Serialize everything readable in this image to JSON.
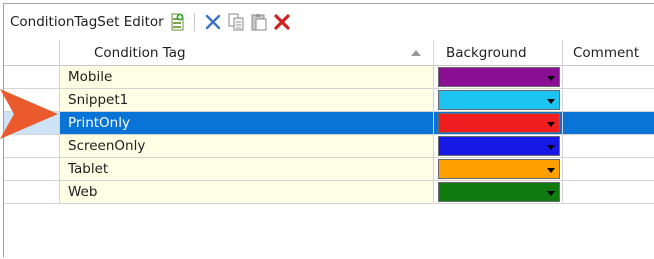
{
  "toolbar": {
    "title": "ConditionTagSet Editor",
    "buttons": [
      {
        "name": "new-tag-button",
        "icon": "add-document-icon"
      },
      {
        "name": "cut-button",
        "icon": "scissors-icon"
      },
      {
        "name": "copy-button",
        "icon": "copy-icon"
      },
      {
        "name": "paste-button",
        "icon": "paste-icon"
      },
      {
        "name": "delete-button",
        "icon": "red-x-icon"
      }
    ]
  },
  "grid": {
    "columns": {
      "tag": "Condition Tag",
      "background": "Background",
      "comment": "Comment"
    },
    "rows": [
      {
        "tag": "Mobile",
        "color": "#8b0f95",
        "comment": ""
      },
      {
        "tag": "Snippet1",
        "color": "#1cc4f2",
        "comment": ""
      },
      {
        "tag": "PrintOnly",
        "color": "#f01e1e",
        "comment": "",
        "selected": true
      },
      {
        "tag": "ScreenOnly",
        "color": "#1717e6",
        "comment": ""
      },
      {
        "tag": "Tablet",
        "color": "#ffa000",
        "comment": ""
      },
      {
        "tag": "Web",
        "color": "#0f7a0f",
        "comment": ""
      }
    ]
  },
  "colors": {
    "selection": "#0a74d6",
    "tag_cell_bg": "#fefee4",
    "callout_arrow": "#ea5a2c"
  }
}
